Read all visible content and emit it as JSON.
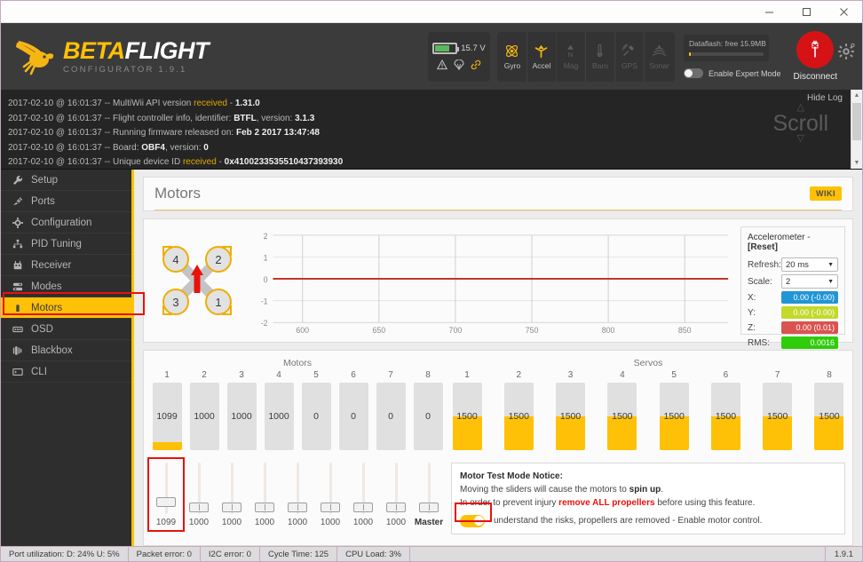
{
  "window": {
    "minimize_label": "–",
    "maximize_label": "□",
    "close_label": "✕"
  },
  "header": {
    "logo_beta": "BETA",
    "logo_flight": "FLIGHT",
    "logo_sub": "CONFIGURATOR  1.9.1",
    "battery_voltage": "15.7 V",
    "sensors": [
      {
        "name": "Gyro",
        "label": "Gyro",
        "active": true
      },
      {
        "name": "Accel",
        "label": "Accel",
        "active": true
      },
      {
        "name": "Mag",
        "label": "Mag",
        "active": false
      },
      {
        "name": "Baro",
        "label": "Baro",
        "active": false
      },
      {
        "name": "GPS",
        "label": "GPS",
        "active": false
      },
      {
        "name": "Sonar",
        "label": "Sonar",
        "active": false
      }
    ],
    "dataflash_label": "Dataflash: free 15.9MB",
    "expert_mode_label": "Enable Expert Mode",
    "expert_mode_on": false,
    "disconnect_label": "Disconnect",
    "accent_yellow": "#ffc107",
    "disconnect_red": "#d51317"
  },
  "log": {
    "hide_label": "Hide Log",
    "scroll_label": "Scroll",
    "lines": [
      {
        "time": "2017-02-10 @ 16:01:37",
        "sep": " -- ",
        "text": "MultiWii API version ",
        "status": "received",
        "tail": " - ",
        "value": "1.31.0"
      },
      {
        "time": "2017-02-10 @ 16:01:37",
        "sep": " -- ",
        "text": "Flight controller info, identifier: ",
        "status": "",
        "tail": "",
        "value": "BTFL",
        "text2": ", version: ",
        "value2": "3.1.3"
      },
      {
        "time": "2017-02-10 @ 16:01:37",
        "sep": " -- ",
        "text": "Running firmware released on: ",
        "status": "",
        "tail": "",
        "value": "Feb 2 2017 13:47:48"
      },
      {
        "time": "2017-02-10 @ 16:01:37",
        "sep": " -- ",
        "text": "Board: ",
        "status": "",
        "tail": "",
        "value": "OBF4",
        "text2": ", version: ",
        "value2": "0"
      },
      {
        "time": "2017-02-10 @ 16:01:37",
        "sep": " -- ",
        "text": "Unique device ID ",
        "status": "received",
        "tail": " - ",
        "value": "0x4100233535510437393930"
      }
    ]
  },
  "sidebar": {
    "items": [
      {
        "label": "Setup",
        "icon": "wrench-icon",
        "active": false
      },
      {
        "label": "Ports",
        "icon": "plug-icon",
        "active": false
      },
      {
        "label": "Configuration",
        "icon": "gear-icon",
        "active": false
      },
      {
        "label": "PID Tuning",
        "icon": "sliders-icon",
        "active": false
      },
      {
        "label": "Receiver",
        "icon": "transmitter-icon",
        "active": false
      },
      {
        "label": "Modes",
        "icon": "switches-icon",
        "active": false
      },
      {
        "label": "Motors",
        "icon": "motor-icon",
        "active": true
      },
      {
        "label": "OSD",
        "icon": "osd-icon",
        "active": false
      },
      {
        "label": "Blackbox",
        "icon": "blackbox-icon",
        "active": false
      },
      {
        "label": "CLI",
        "icon": "terminal-icon",
        "active": false
      }
    ]
  },
  "page": {
    "title": "Motors",
    "wiki_label": "WIKI"
  },
  "quad": {
    "motor_positions": [
      {
        "id": "4",
        "pos": "top-left"
      },
      {
        "id": "2",
        "pos": "top-right"
      },
      {
        "id": "3",
        "pos": "bottom-left"
      },
      {
        "id": "1",
        "pos": "bottom-right"
      }
    ]
  },
  "chart_data": {
    "type": "line",
    "title": "",
    "xlabel": "",
    "ylabel": "",
    "x_ticks": [
      600,
      650,
      700,
      750,
      800,
      850
    ],
    "y_ticks": [
      2,
      1,
      0,
      -1,
      -2
    ],
    "xlim": [
      590,
      890
    ],
    "ylim": [
      -2,
      2
    ],
    "grid": true,
    "series": [
      {
        "name": "accelerometer",
        "color": "#c0392b",
        "values": [
          0,
          0,
          0,
          0,
          0,
          0,
          0
        ]
      }
    ]
  },
  "accelerometer": {
    "title_prefix": "Accelerometer - ",
    "title_reset": "[Reset]",
    "refresh_label": "Refresh:",
    "refresh_value": "20 ms",
    "scale_label": "Scale:",
    "scale_value": "2",
    "rows": [
      {
        "key": "X:",
        "value": "0.00 (-0.00)",
        "color": "#2196d6"
      },
      {
        "key": "Y:",
        "value": "0.00 (-0.00)",
        "color": "#c3d92b"
      },
      {
        "key": "Z:",
        "value": "0.00 (0.01)",
        "color": "#d9534f"
      },
      {
        "key": "RMS:",
        "value": "0.0016",
        "color": "#2fcc0a"
      }
    ]
  },
  "motors": {
    "section_title": "Motors",
    "bars": [
      {
        "index": "1",
        "value": "1099",
        "fill_pct": 12
      },
      {
        "index": "2",
        "value": "1000",
        "fill_pct": 0
      },
      {
        "index": "3",
        "value": "1000",
        "fill_pct": 0
      },
      {
        "index": "4",
        "value": "1000",
        "fill_pct": 0
      },
      {
        "index": "5",
        "value": "0",
        "fill_pct": 0
      },
      {
        "index": "6",
        "value": "0",
        "fill_pct": 0
      },
      {
        "index": "7",
        "value": "0",
        "fill_pct": 0
      },
      {
        "index": "8",
        "value": "0",
        "fill_pct": 0
      }
    ],
    "sliders": [
      {
        "label": "1099",
        "handle_pct": 68,
        "highlighted": true
      },
      {
        "label": "1000",
        "handle_pct": 78,
        "highlighted": false
      },
      {
        "label": "1000",
        "handle_pct": 78,
        "highlighted": false
      },
      {
        "label": "1000",
        "handle_pct": 78,
        "highlighted": false
      },
      {
        "label": "1000",
        "handle_pct": 78,
        "highlighted": false
      },
      {
        "label": "1000",
        "handle_pct": 78,
        "highlighted": false
      },
      {
        "label": "1000",
        "handle_pct": 78,
        "highlighted": false
      },
      {
        "label": "1000",
        "handle_pct": 78,
        "highlighted": false
      },
      {
        "label": "Master",
        "handle_pct": 78,
        "highlighted": false,
        "master": true
      }
    ]
  },
  "servos": {
    "section_title": "Servos",
    "bars": [
      {
        "index": "1",
        "value": "1500",
        "fill_pct": 50
      },
      {
        "index": "2",
        "value": "1500",
        "fill_pct": 50
      },
      {
        "index": "3",
        "value": "1500",
        "fill_pct": 50
      },
      {
        "index": "4",
        "value": "1500",
        "fill_pct": 50
      },
      {
        "index": "5",
        "value": "1500",
        "fill_pct": 50
      },
      {
        "index": "6",
        "value": "1500",
        "fill_pct": 50
      },
      {
        "index": "7",
        "value": "1500",
        "fill_pct": 50
      },
      {
        "index": "8",
        "value": "1500",
        "fill_pct": 50
      }
    ]
  },
  "notice": {
    "heading": "Motor Test Mode Notice:",
    "line1_a": "Moving the sliders will cause the motors to ",
    "line1_b": "spin up",
    "line1_c": ".",
    "line2_a": "In order to prevent injury ",
    "line2_b": "remove ALL propellers",
    "line2_c": " before using this feature.",
    "toggle_on": true,
    "toggle_text": "understand the risks, propellers are removed - Enable motor control."
  },
  "statusbar": {
    "cells": [
      "Port utilization: D: 24% U: 5%",
      "Packet error: 0",
      "I2C error: 0",
      "Cycle Time: 125",
      "CPU Load: 3%"
    ],
    "version": "1.9.1"
  }
}
